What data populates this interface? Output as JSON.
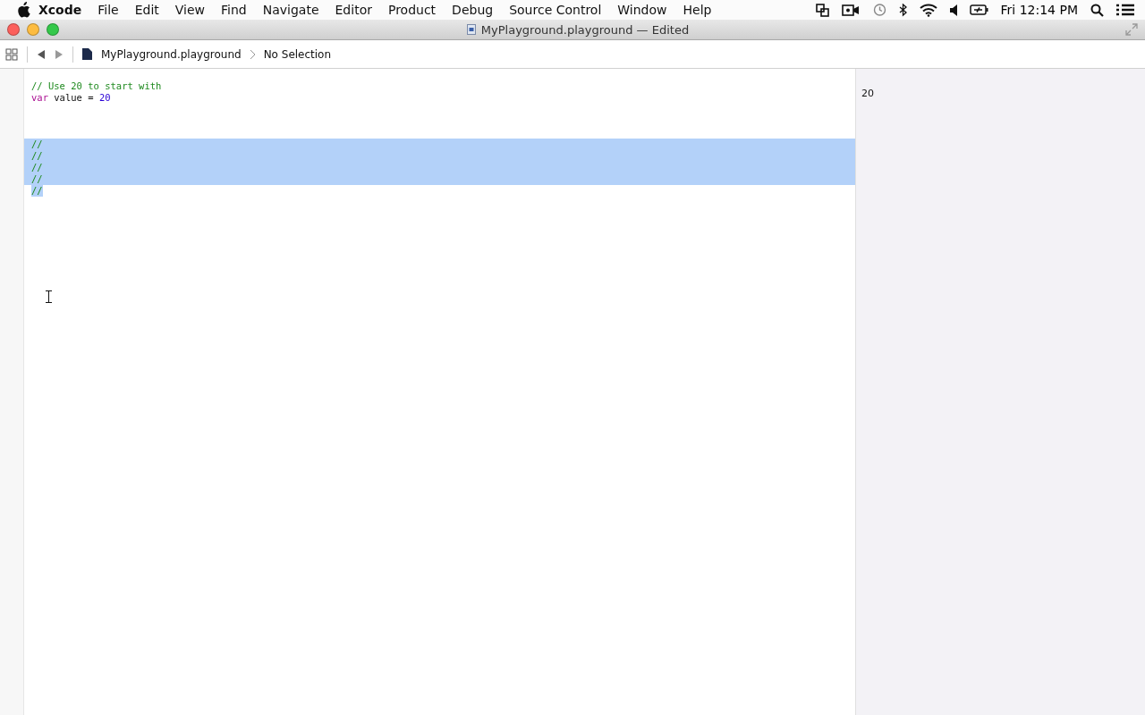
{
  "menu_bar": {
    "app": "Xcode",
    "items": [
      "File",
      "Edit",
      "View",
      "Find",
      "Navigate",
      "Editor",
      "Product",
      "Debug",
      "Source Control",
      "Window",
      "Help"
    ],
    "clock": "Fri 12:14 PM"
  },
  "window": {
    "title": "MyPlayground.playground — Edited"
  },
  "jump_bar": {
    "file": "MyPlayground.playground",
    "selection": "No Selection"
  },
  "editor": {
    "blocks": [
      {
        "lines": [
          {
            "selected": false,
            "tokens": [
              {
                "kind": "comment",
                "text": "// Use 20 to start with"
              }
            ]
          },
          {
            "selected": false,
            "tokens": [
              {
                "kind": "keyword",
                "text": "var"
              },
              {
                "kind": "plain",
                "text": " value = "
              },
              {
                "kind": "number",
                "text": "20"
              }
            ]
          }
        ]
      },
      {
        "lines": [
          {
            "selected": true,
            "tokens": [
              {
                "kind": "comment",
                "text": "//"
              }
            ]
          },
          {
            "selected": true,
            "tokens": [
              {
                "kind": "comment",
                "text": "//"
              }
            ]
          },
          {
            "selected": true,
            "tokens": [
              {
                "kind": "comment",
                "text": "//"
              }
            ]
          },
          {
            "selected": true,
            "tokens": [
              {
                "kind": "comment",
                "text": "//"
              }
            ]
          },
          {
            "selected": true,
            "tokens": [
              {
                "kind": "comment",
                "text": "//"
              }
            ]
          }
        ]
      }
    ]
  },
  "results": [
    "20"
  ]
}
